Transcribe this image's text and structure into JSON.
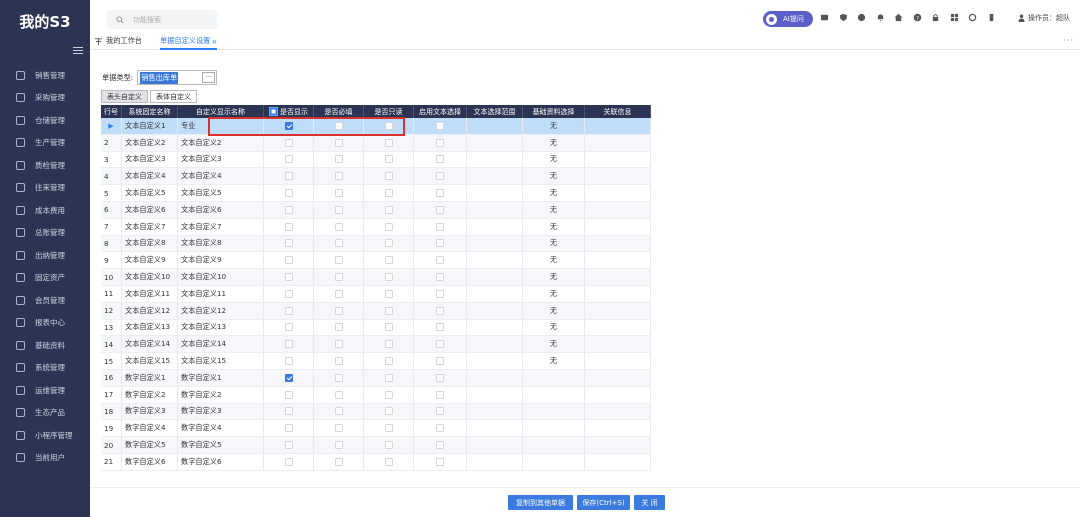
{
  "app": {
    "title": "我的S3"
  },
  "sidebar": {
    "items": [
      {
        "label": "销售管理",
        "icon": "sales-icon"
      },
      {
        "label": "采购管理",
        "icon": "cart-icon"
      },
      {
        "label": "仓储管理",
        "icon": "warehouse-icon"
      },
      {
        "label": "生产管理",
        "icon": "production-icon"
      },
      {
        "label": "质检管理",
        "icon": "shield-icon"
      },
      {
        "label": "往来管理",
        "icon": "exchange-icon"
      },
      {
        "label": "成本费用",
        "icon": "cost-icon"
      },
      {
        "label": "总账管理",
        "icon": "ledger-icon"
      },
      {
        "label": "出纳管理",
        "icon": "cashier-icon"
      },
      {
        "label": "固定资产",
        "icon": "asset-icon"
      },
      {
        "label": "会员管理",
        "icon": "member-icon"
      },
      {
        "label": "报表中心",
        "icon": "report-icon"
      },
      {
        "label": "基础资料",
        "icon": "database-icon"
      },
      {
        "label": "系统管理",
        "icon": "settings-icon"
      },
      {
        "label": "运维管理",
        "icon": "monitor-icon"
      },
      {
        "label": "生态产品",
        "icon": "product-icon"
      },
      {
        "label": "小程序管理",
        "icon": "miniapp-icon"
      },
      {
        "label": "当前用户",
        "icon": "user-icon"
      }
    ]
  },
  "header": {
    "search_placeholder": "功能搜索",
    "ai_label": "AI提问",
    "operator": "操作员：超队"
  },
  "tabs": [
    {
      "label": "我的工作台"
    },
    {
      "label": "单据自定义设置"
    }
  ],
  "form": {
    "doc_type_label": "单据类型:",
    "doc_type_value": "销售出库单",
    "doc_type_button": "···"
  },
  "subtabs": [
    {
      "label": "表头自定义",
      "active": true
    },
    {
      "label": "表体自定义",
      "active": false
    }
  ],
  "grid": {
    "columns": [
      "行号",
      "系统固定名称",
      "自定义显示名称",
      "是否显示",
      "是否必填",
      "是否只读",
      "启用文本选择",
      "文本选择范围",
      "基础资料选择",
      "关联信息"
    ],
    "rows": [
      {
        "no": "1",
        "sys": "文本自定义1",
        "disp": "专业",
        "show": true,
        "basic": "无",
        "selected": true
      },
      {
        "no": "2",
        "sys": "文本自定义2",
        "disp": "文本自定义2",
        "show": false,
        "basic": "无"
      },
      {
        "no": "3",
        "sys": "文本自定义3",
        "disp": "文本自定义3",
        "show": false,
        "basic": "无"
      },
      {
        "no": "4",
        "sys": "文本自定义4",
        "disp": "文本自定义4",
        "show": false,
        "basic": "无"
      },
      {
        "no": "5",
        "sys": "文本自定义5",
        "disp": "文本自定义5",
        "show": false,
        "basic": "无"
      },
      {
        "no": "6",
        "sys": "文本自定义6",
        "disp": "文本自定义6",
        "show": false,
        "basic": "无"
      },
      {
        "no": "7",
        "sys": "文本自定义7",
        "disp": "文本自定义7",
        "show": false,
        "basic": "无"
      },
      {
        "no": "8",
        "sys": "文本自定义8",
        "disp": "文本自定义8",
        "show": false,
        "basic": "无"
      },
      {
        "no": "9",
        "sys": "文本自定义9",
        "disp": "文本自定义9",
        "show": false,
        "basic": "无"
      },
      {
        "no": "10",
        "sys": "文本自定义10",
        "disp": "文本自定义10",
        "show": false,
        "basic": "无"
      },
      {
        "no": "11",
        "sys": "文本自定义11",
        "disp": "文本自定义11",
        "show": false,
        "basic": "无"
      },
      {
        "no": "12",
        "sys": "文本自定义12",
        "disp": "文本自定义12",
        "show": false,
        "basic": "无"
      },
      {
        "no": "13",
        "sys": "文本自定义13",
        "disp": "文本自定义13",
        "show": false,
        "basic": "无"
      },
      {
        "no": "14",
        "sys": "文本自定义14",
        "disp": "文本自定义14",
        "show": false,
        "basic": "无"
      },
      {
        "no": "15",
        "sys": "文本自定义15",
        "disp": "文本自定义15",
        "show": false,
        "basic": "无"
      },
      {
        "no": "16",
        "sys": "数字自定义1",
        "disp": "数字自定义1",
        "show": true,
        "basic": ""
      },
      {
        "no": "17",
        "sys": "数字自定义2",
        "disp": "数字自定义2",
        "show": false,
        "basic": ""
      },
      {
        "no": "18",
        "sys": "数字自定义3",
        "disp": "数字自定义3",
        "show": false,
        "basic": ""
      },
      {
        "no": "19",
        "sys": "数字自定义4",
        "disp": "数字自定义4",
        "show": false,
        "basic": ""
      },
      {
        "no": "20",
        "sys": "数字自定义5",
        "disp": "数字自定义5",
        "show": false,
        "basic": ""
      },
      {
        "no": "21",
        "sys": "数字自定义6",
        "disp": "数字自定义6",
        "show": false,
        "basic": ""
      }
    ]
  },
  "footer": {
    "copy_button": "复制到其他单据",
    "save_button": "保存(Ctrl+S)",
    "close_button": "关 闭"
  },
  "colors": {
    "sidebar": "#2b3553",
    "accent": "#3b7be0",
    "highlight": "#d8302c"
  }
}
